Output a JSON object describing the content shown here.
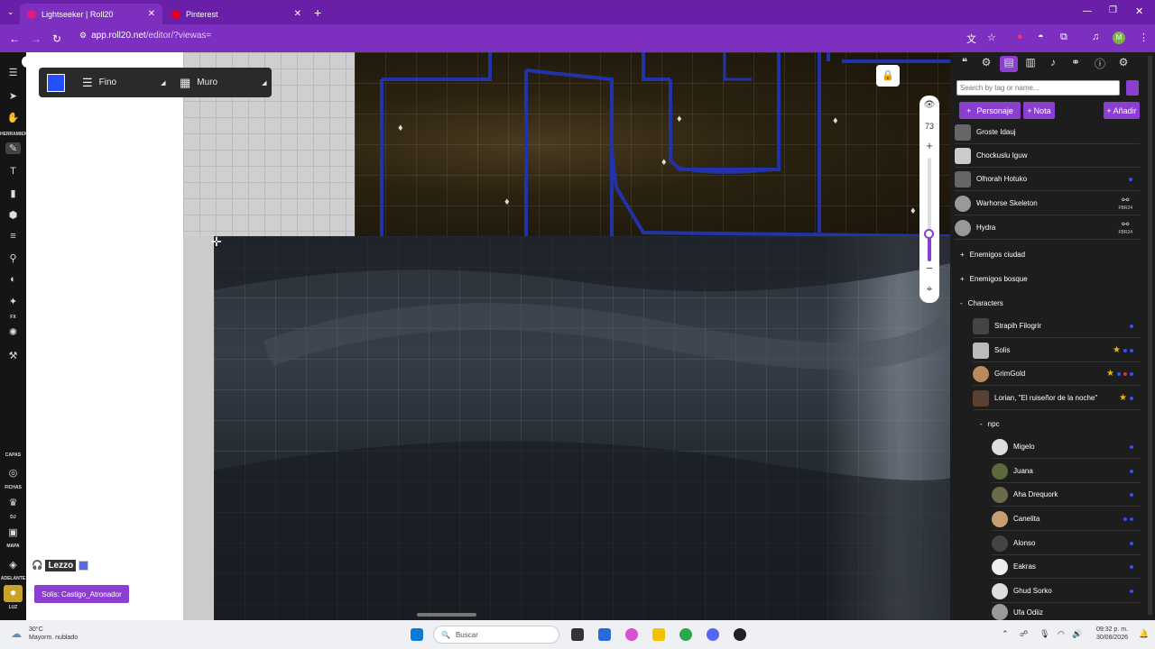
{
  "browser": {
    "tabs": [
      {
        "label": "Lightseeker | Roll20",
        "active": true
      },
      {
        "label": "Pinterest",
        "active": false
      }
    ],
    "new_tab": "+",
    "url_host": "app.roll20.net",
    "url_path": "/editor/?viewas=",
    "profile_initial": "M"
  },
  "left_toolbar": {
    "labels": [
      "HERRAMIENTAS",
      "FX",
      "CAPAS",
      "FICHAS",
      "DJ",
      "MAPA",
      "ADELANTE",
      "LUZ"
    ]
  },
  "draw_toolbar": {
    "color": "#2450ff",
    "stroke_label": "Fino",
    "shape_label": "Muro"
  },
  "zoom": {
    "value": "73",
    "level_fraction": 0.3
  },
  "journal": {
    "search_placeholder": "Search by tag or name...",
    "buttons": {
      "character": "Personaje",
      "note": "Nota",
      "add": "Añadir"
    },
    "top_entries": [
      {
        "name": "Groste Idauj",
        "badge": ""
      },
      {
        "name": "Chockuslu Iguw",
        "badge": ""
      },
      {
        "name": "Olhorah Hotuko",
        "badge": ""
      },
      {
        "name": "Warhorse Skeleton",
        "badge": "FBR24"
      },
      {
        "name": "Hydra",
        "badge": "FBR24"
      }
    ],
    "folders": [
      "Enemigos ciudad",
      "Enemigos bosque",
      "Characters"
    ],
    "characters": [
      {
        "name": "Strapih Filogrir"
      },
      {
        "name": "Solis"
      },
      {
        "name": "GrimGold"
      },
      {
        "name": "Lorian, \"El ruiseñor de la noche\""
      }
    ],
    "subfolder": "npc",
    "npcs": [
      {
        "name": "Migelo"
      },
      {
        "name": "Juana"
      },
      {
        "name": "Aha Drequork"
      },
      {
        "name": "Canelita"
      },
      {
        "name": "Alonso"
      },
      {
        "name": "Eakras"
      },
      {
        "name": "Ghud Sorko"
      },
      {
        "name": "Ufa Odiiz"
      }
    ]
  },
  "chat": {
    "player": "Lezzo",
    "macro": "Solis: Castigo_Atronador"
  },
  "taskbar": {
    "temp": "30°C",
    "weather": "Mayorm. nublado",
    "search": "Buscar",
    "time": "09:32 p. m.",
    "date": "30/08/2026"
  },
  "colors": {
    "accent": "#8a3fd0",
    "chrome": "#7d2fc0"
  }
}
